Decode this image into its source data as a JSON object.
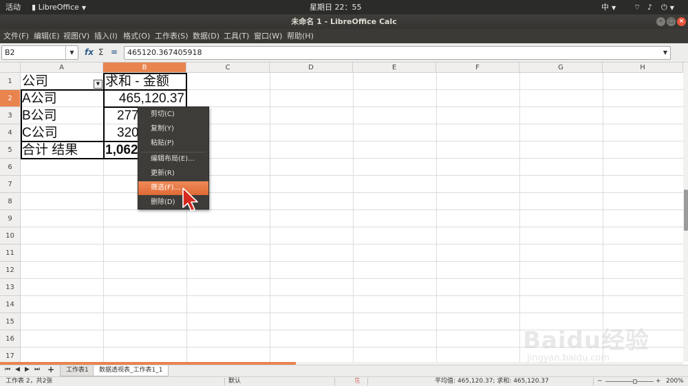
{
  "topbar": {
    "activities": "活动",
    "app_name": "LibreOffice",
    "clock": "星期日 22：55",
    "input_method": "中"
  },
  "window": {
    "title": "未命名 1 - LibreOffice Calc"
  },
  "menubar": {
    "items": [
      "文件(F)",
      "编辑(E)",
      "视图(V)",
      "插入(I)",
      "格式(O)",
      "工作表(S)",
      "数据(D)",
      "工具(T)",
      "窗口(W)",
      "帮助(H)"
    ]
  },
  "formulabar": {
    "name_box": "B2",
    "formula": "465120.367405918"
  },
  "grid": {
    "columns": [
      "A",
      "B",
      "C",
      "D",
      "E",
      "F",
      "G",
      "H"
    ],
    "rows": [
      "1",
      "2",
      "3",
      "4",
      "5",
      "6",
      "7",
      "8",
      "9",
      "10",
      "11",
      "12",
      "13",
      "14",
      "15",
      "16",
      "17"
    ],
    "cells": {
      "A1": "公司",
      "B1": "求和 - 金额",
      "A2": "A公司",
      "B2": "465,120.37",
      "A3": "B公司",
      "B3": "277",
      "A4": "C公司",
      "B4": "320",
      "A5": "合计 结果",
      "B5": "1,062"
    }
  },
  "context_menu": {
    "items": [
      "剪切(C)",
      "复制(Y)",
      "粘贴(P)",
      "编辑布局(E)...",
      "更新(R)",
      "筛选(F)...",
      "删除(D)"
    ],
    "highlighted": "筛选(F)...",
    "highlight_color": "#e9844f"
  },
  "sheet_tabs": [
    "工作表1",
    "数据透视表_工作表1_1"
  ],
  "statusbar": {
    "sheet_info": "工作表 2，共2张",
    "page_style": "默认",
    "summary": "平均值: 465,120.37; 求和: 465,120.37",
    "zoom": "200%"
  },
  "watermark": {
    "brand": "Baidu经验",
    "url": "jingyan.baidu.com"
  },
  "colors": {
    "accent": "#e9844f",
    "topbar": "#2b2b2a",
    "menubar": "#3b3a37"
  }
}
